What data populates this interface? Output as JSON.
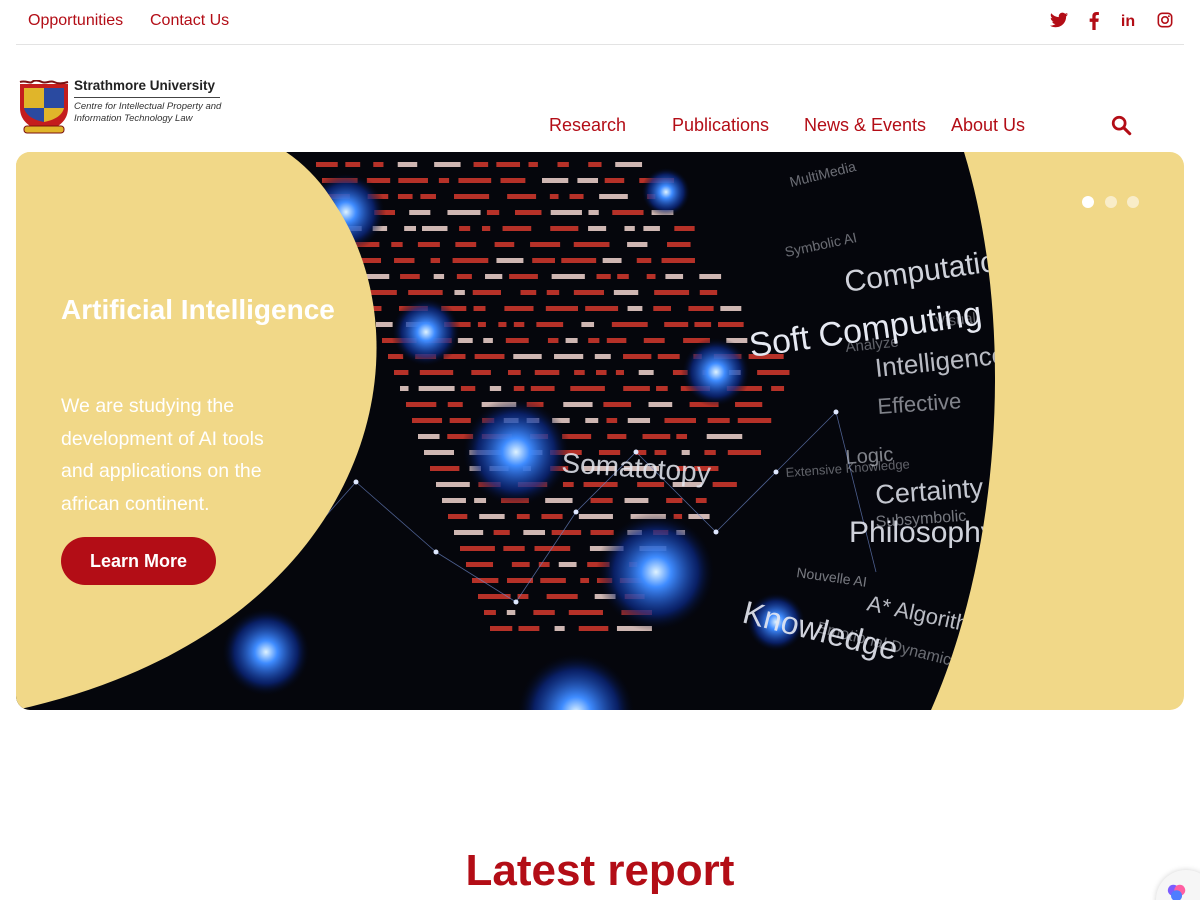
{
  "topbar": {
    "links": [
      "Opportunities",
      "Contact Us"
    ],
    "social": [
      {
        "name": "twitter-icon",
        "glyph": "t"
      },
      {
        "name": "facebook-icon",
        "glyph": "f"
      },
      {
        "name": "linkedin-icon",
        "glyph": "in"
      },
      {
        "name": "instagram-icon",
        "glyph": "◎"
      }
    ]
  },
  "logo": {
    "university": "Strathmore University",
    "centre": "Centre for Intellectual Property and Information Technology Law"
  },
  "nav": {
    "items": [
      "Research",
      "Publications",
      "News & Events",
      "About Us"
    ],
    "search_icon": "search-icon"
  },
  "hero": {
    "title": "Artificial Intelligence",
    "text": "We are studying the development of AI tools and applications on the african continent.",
    "button": "Learn More",
    "slides": 3,
    "active_slide": 1,
    "image_words": [
      "Soft Computing",
      "Computation",
      "Intelligence",
      "Effective",
      "Somatotopy",
      "Logic",
      "Extensive Knowledge",
      "Certainty",
      "Philosophy",
      "Nouvelle AI",
      "A* Algorithm",
      "Knowledge",
      "Symbolic AI",
      "Subsymbolic",
      "Emotional Dynamics",
      "Analyze",
      "Visual",
      "MultiMedia"
    ]
  },
  "report": {
    "title": "Latest report"
  },
  "colors": {
    "brand": "#b30d16",
    "sand": "#f1d888",
    "hero_dark": "#05060c"
  }
}
